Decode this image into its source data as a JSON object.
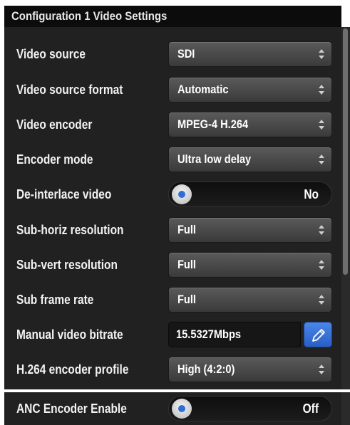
{
  "panel": {
    "title": "Configuration 1 Video Settings",
    "rows": [
      {
        "label": "Video source",
        "type": "select",
        "value": "SDI"
      },
      {
        "label": "Video source format",
        "type": "select",
        "value": "Automatic"
      },
      {
        "label": "Video encoder",
        "type": "select",
        "value": "MPEG-4 H.264"
      },
      {
        "label": "Encoder mode",
        "type": "select",
        "value": "Ultra low delay"
      },
      {
        "label": "De-interlace video",
        "type": "toggle",
        "value": "No"
      },
      {
        "label": "Sub-horiz resolution",
        "type": "select",
        "value": "Full"
      },
      {
        "label": "Sub-vert resolution",
        "type": "select",
        "value": "Full"
      },
      {
        "label": "Sub frame rate",
        "type": "select",
        "value": "Full"
      },
      {
        "label": "Manual video bitrate",
        "type": "text",
        "value": "15.5327Mbps"
      },
      {
        "label": "H.264 encoder profile",
        "type": "select",
        "value": "High (4:2:0)"
      }
    ]
  },
  "anc_panel": {
    "label": "ANC Encoder Enable",
    "value": "Off"
  },
  "icons": {
    "select_arrows": "up-down-arrows-icon",
    "edit": "pencil-icon",
    "toggle_knob": "toggle-knob-icon"
  },
  "colors": {
    "panel_bg": "#212121",
    "title_bg": "#0c0c0c",
    "edit_button": "#3a74d8",
    "knob_dot": "#2f6fd6"
  }
}
